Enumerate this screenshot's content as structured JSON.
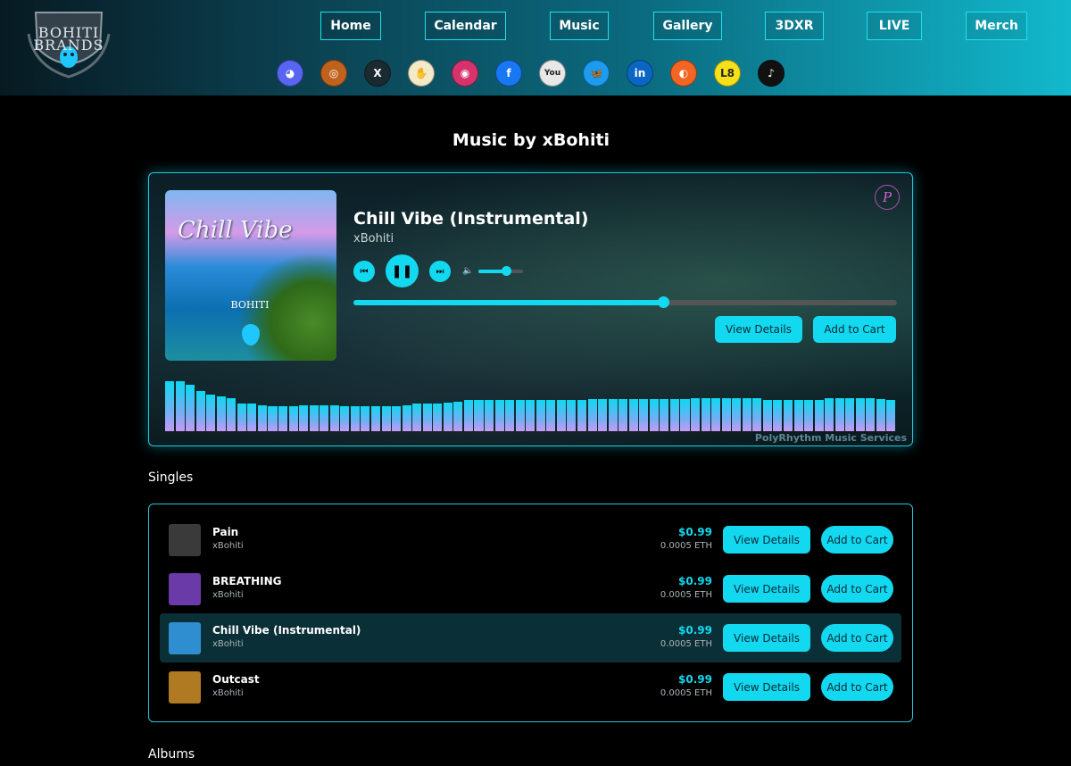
{
  "brand": {
    "logo_text": "BOHITI BRANDS"
  },
  "nav": {
    "items": [
      {
        "label": "Home"
      },
      {
        "label": "Calendar"
      },
      {
        "label": "Music"
      },
      {
        "label": "Gallery"
      },
      {
        "label": "3DXR"
      },
      {
        "label": "LIVE"
      },
      {
        "label": "Merch"
      }
    ]
  },
  "social": [
    {
      "icon": "discord-icon",
      "glyph": "◕",
      "color": "#5865f2"
    },
    {
      "icon": "fingerprint-icon",
      "glyph": "◎",
      "color": "#c0621e"
    },
    {
      "icon": "x-icon",
      "glyph": "X",
      "color": "#1a2a30"
    },
    {
      "icon": "hand-icon",
      "glyph": "✋",
      "color": "#f4e9c8"
    },
    {
      "icon": "instagram-icon",
      "glyph": "◉",
      "color": "#d6336c"
    },
    {
      "icon": "facebook-icon",
      "glyph": "f",
      "color": "#1877f2"
    },
    {
      "icon": "youtube-icon",
      "glyph": "You",
      "color": "#e8e8e8"
    },
    {
      "icon": "bluesky-icon",
      "glyph": "🦋",
      "color": "#1d9bf0"
    },
    {
      "icon": "linkedin-icon",
      "glyph": "in",
      "color": "#0a66c2"
    },
    {
      "icon": "patreon-icon",
      "glyph": "◐",
      "color": "#f26522"
    },
    {
      "icon": "lemon8-icon",
      "glyph": "L8",
      "color": "#f5e11a"
    },
    {
      "icon": "tiktok-icon",
      "glyph": "♪",
      "color": "#111111"
    }
  ],
  "page": {
    "title": "Music by xBohiti"
  },
  "player": {
    "cover_text": "Chill Vibe",
    "cover_logo": "BOHITI",
    "title": "Chill Vibe (Instrumental)",
    "artist": "xBohiti",
    "progress": 0.57,
    "volume": 0.62,
    "view_details_label": "View Details",
    "add_to_cart_label": "Add to Cart",
    "service_label": "PolyRhythm Music Services",
    "service_icon_glyph": "P",
    "visualizer_levels": [
      1.0,
      1.0,
      0.92,
      0.8,
      0.73,
      0.7,
      0.66,
      0.55,
      0.55,
      0.52,
      0.5,
      0.5,
      0.5,
      0.52,
      0.52,
      0.52,
      0.52,
      0.5,
      0.5,
      0.5,
      0.5,
      0.5,
      0.5,
      0.52,
      0.55,
      0.55,
      0.55,
      0.57,
      0.59,
      0.62,
      0.62,
      0.62,
      0.62,
      0.62,
      0.62,
      0.62,
      0.62,
      0.62,
      0.62,
      0.62,
      0.62,
      0.64,
      0.64,
      0.64,
      0.64,
      0.64,
      0.64,
      0.64,
      0.64,
      0.64,
      0.64,
      0.66,
      0.66,
      0.66,
      0.66,
      0.66,
      0.66,
      0.66,
      0.62,
      0.62,
      0.62,
      0.62,
      0.62,
      0.62,
      0.66,
      0.66,
      0.66,
      0.66,
      0.66,
      0.64,
      0.62
    ]
  },
  "sections": {
    "singles": "Singles",
    "albums": "Albums"
  },
  "singles": [
    {
      "title": "Pain",
      "artist": "xBohiti",
      "price_usd": "$0.99",
      "price_eth": "0.0005 ETH",
      "view_label": "View Details",
      "cart_label": "Add to Cart",
      "thumb": "#3a3a3a",
      "active": false
    },
    {
      "title": "BREATHING",
      "artist": "xBohiti",
      "price_usd": "$0.99",
      "price_eth": "0.0005 ETH",
      "view_label": "View Details",
      "cart_label": "Add to Cart",
      "thumb": "#6a3aa8",
      "active": false
    },
    {
      "title": "Chill Vibe (Instrumental)",
      "artist": "xBohiti",
      "price_usd": "$0.99",
      "price_eth": "0.0005 ETH",
      "view_label": "View Details",
      "cart_label": "Add to Cart",
      "thumb": "#2f8ecf",
      "active": true
    },
    {
      "title": "Outcast",
      "artist": "xBohiti",
      "price_usd": "$0.99",
      "price_eth": "0.0005 ETH",
      "view_label": "View Details",
      "cart_label": "Add to Cart",
      "thumb": "#b07a22",
      "active": false
    }
  ]
}
